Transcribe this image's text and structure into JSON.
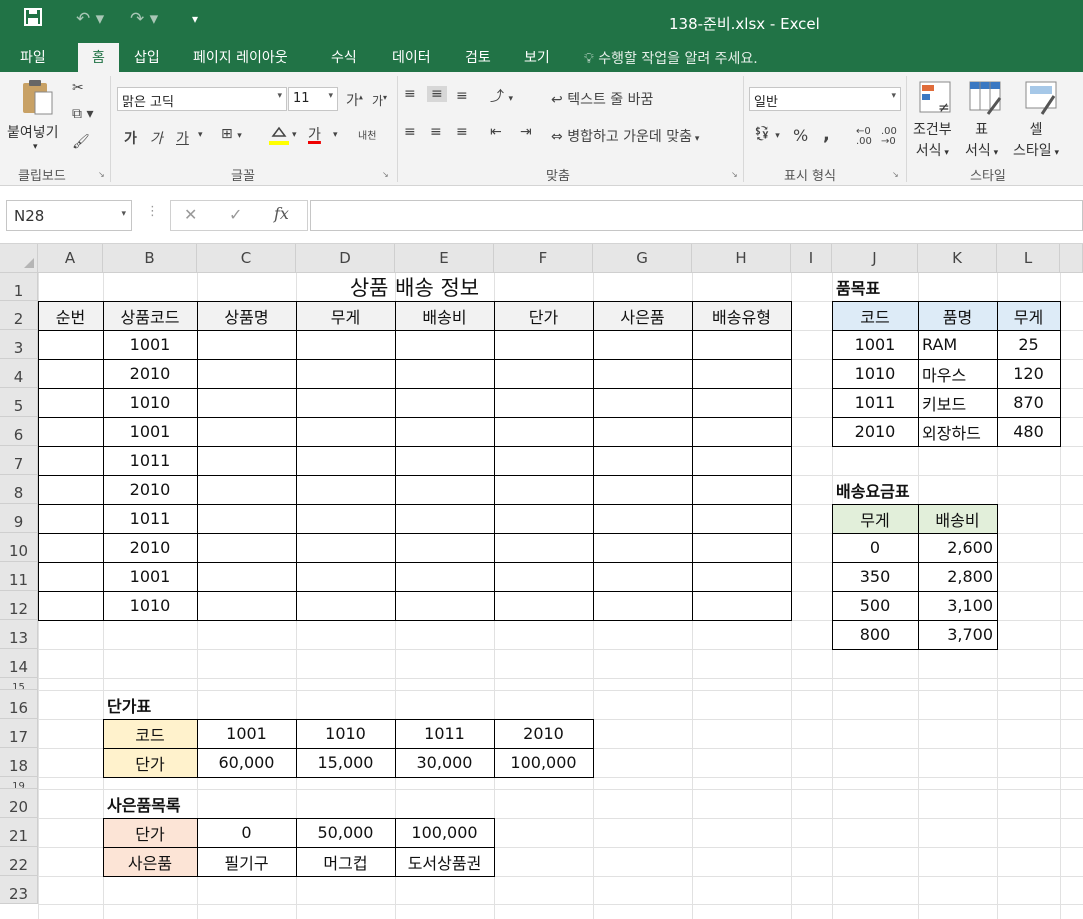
{
  "titlebar": {
    "title": "138-준비.xlsx  -  Excel",
    "save_icon": "save-icon",
    "undo_icon": "undo-icon",
    "redo_icon": "redo-icon"
  },
  "tabs": [
    "파일",
    "홈",
    "삽입",
    "페이지 레이아웃",
    "수식",
    "데이터",
    "검토",
    "보기"
  ],
  "tell_me": "수행할 작업을 알려 주세요.",
  "ribbon": {
    "clipboard": {
      "label": "클립보드",
      "paste": "붙여넣기"
    },
    "font": {
      "label": "글꼴",
      "name": "맑은 고딕",
      "size": "11",
      "grow": "가",
      "shrink": "가",
      "bold": "가",
      "italic": "가",
      "underline": "가",
      "font_color": "가",
      "phonetic": "내천"
    },
    "alignment": {
      "label": "맞춤",
      "wrap": "텍스트 줄 바꿈",
      "merge": "병합하고 가운데 맞춤"
    },
    "number": {
      "label": "표시 형식",
      "format": "일반",
      "percent": "%",
      "comma": ","
    },
    "styles": {
      "label": "스타일",
      "cond_format": [
        "조건부",
        "서식"
      ],
      "table_format": [
        "표",
        "서식"
      ],
      "cell_styles": [
        "셀",
        "스타일"
      ]
    }
  },
  "formula_bar": {
    "name_box": "N28",
    "cancel": "✕",
    "enter": "✓",
    "fx": "fx",
    "value": ""
  },
  "columns": [
    "A",
    "B",
    "C",
    "D",
    "E",
    "F",
    "G",
    "H",
    "I",
    "J",
    "K",
    "L"
  ],
  "rows": [
    "1",
    "2",
    "3",
    "4",
    "5",
    "6",
    "7",
    "8",
    "9",
    "10",
    "11",
    "12",
    "13",
    "14",
    "15",
    "16",
    "17",
    "18",
    "19",
    "20",
    "21",
    "22",
    "23"
  ],
  "sheet": {
    "title": "상품 배송 정보",
    "headers": [
      "순번",
      "상품코드",
      "상품명",
      "무게",
      "배송비",
      "단가",
      "사은품",
      "배송유형"
    ],
    "codes": [
      "1001",
      "2010",
      "1010",
      "1001",
      "1011",
      "2010",
      "1011",
      "2010",
      "1001",
      "1010"
    ],
    "item_table": {
      "title": "품목표",
      "headers": [
        "코드",
        "품명",
        "무게"
      ],
      "rows": [
        [
          "1001",
          "RAM",
          "25"
        ],
        [
          "1010",
          "마우스",
          "120"
        ],
        [
          "1011",
          "키보드",
          "870"
        ],
        [
          "2010",
          "외장하드",
          "480"
        ]
      ]
    },
    "fee_table": {
      "title": "배송요금표",
      "headers": [
        "무게",
        "배송비"
      ],
      "rows": [
        [
          "0",
          "2,600"
        ],
        [
          "350",
          "2,800"
        ],
        [
          "500",
          "3,100"
        ],
        [
          "800",
          "3,700"
        ]
      ]
    },
    "price_table": {
      "title": "단가표",
      "row1": [
        "코드",
        "1001",
        "1010",
        "1011",
        "2010"
      ],
      "row2": [
        "단가",
        "60,000",
        "15,000",
        "30,000",
        "100,000"
      ]
    },
    "gift_table": {
      "title": "사은품목록",
      "row1": [
        "단가",
        "0",
        "50,000",
        "100,000"
      ],
      "row2": [
        "사은품",
        "필기구",
        "머그컵",
        "도서상품권"
      ]
    }
  },
  "colors": {
    "excel_green": "#217346",
    "header_fill": "#f2f2f2",
    "item_header_fill": "#ddebf7",
    "fee_header_fill": "#e2efda",
    "price_label_fill": "#fff2cc",
    "gift_label_fill": "#fce4d6"
  }
}
